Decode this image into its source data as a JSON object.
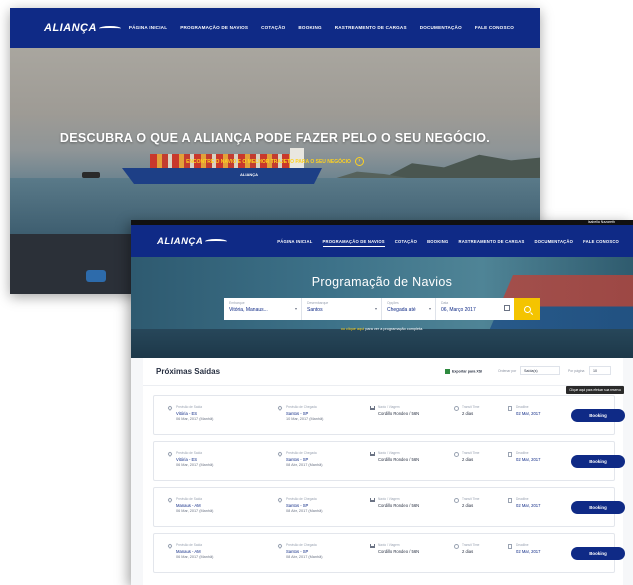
{
  "home": {
    "logo": "ALIANÇA",
    "menu": [
      "PÁGINA INICIAL",
      "PROGRAMAÇÃO DE NAVIOS",
      "COTAÇÃO",
      "BOOKING",
      "RASTREAMENTO DE CARGAS",
      "DOCUMENTAÇÃO",
      "FALE CONOSCO"
    ],
    "headline": "DESCUBRA O QUE A ALIANÇA PODE FAZER PELO O SEU NEGÓCIO.",
    "cta": "ENCONTRE O NAVIO E O MELHOR TRAJETO PARA O SEU NEGÓCIO",
    "ship_brand": "ALIANÇA"
  },
  "schedule": {
    "topbar_user": "Isabella Nazareth",
    "logo": "ALIANÇA",
    "menu": [
      "PÁGINA INICIAL",
      "PROGRAMAÇÃO DE NAVIOS",
      "COTAÇÃO",
      "BOOKING",
      "RASTREAMENTO DE CARGAS",
      "DOCUMENTAÇÃO",
      "FALE CONOSCO"
    ],
    "title": "Programação de Navios",
    "search": {
      "origin_label": "Embarque",
      "origin_value": "Vitória, Manaus...",
      "dest_label": "Desembarque",
      "dest_value": "Santos",
      "type_label": "Opções",
      "type_value": "Chegada até",
      "date_label": "Data",
      "date_value": "06, Março 2017"
    },
    "hint_link": "ou clique aqui",
    "hint_rest": "para ver a programação completa.",
    "panel_title": "Próximas Saídas",
    "export_label": "Exportar para XSl",
    "order_label": "Ordenar por",
    "order_value": "Saída(s)",
    "per_page_label": "Por página",
    "per_page_value": "10",
    "tooltip": "Clique aqui para efetuar sua reserva",
    "row_labels": {
      "origin": "Previsão de Saída",
      "dest": "Previsão de Chegada",
      "vessel": "Navio / Viagem",
      "transit": "Transit Time",
      "deadline": "Deadline",
      "book": "Booking"
    },
    "rows": [
      {
        "origin": "Vitória - ES",
        "origin_date": "06 Mar, 2017 (Manhã)",
        "dest": "Santos - SP",
        "dest_date": "10 Mar, 2017 (Manhã)",
        "vessel": "Cordillo Rondeo / 56N",
        "transit": "2 dias",
        "deadline": "02 Mar, 2017"
      },
      {
        "origin": "Vitória - ES",
        "origin_date": "06 Mar, 2017 (Manhã)",
        "dest": "Santos - SP",
        "dest_date": "08 Abr, 2017 (Manhã)",
        "vessel": "Cordillo Rondeo / 56N",
        "transit": "2 dias",
        "deadline": "02 Mar, 2017"
      },
      {
        "origin": "Manaus - AM",
        "origin_date": "06 Mar, 2017 (Manhã)",
        "dest": "Santos - SP",
        "dest_date": "08 Abr, 2017 (Manhã)",
        "vessel": "Cordillo Rondeo / 56N",
        "transit": "2 dias",
        "deadline": "02 Mar, 2017"
      },
      {
        "origin": "Manaus - AM",
        "origin_date": "06 Mar, 2017 (Manhã)",
        "dest": "Santos - SP",
        "dest_date": "08 Abr, 2017 (Manhã)",
        "vessel": "Cordillo Rondeo / 56N",
        "transit": "2 dias",
        "deadline": "02 Mar, 2017"
      }
    ]
  },
  "colors": {
    "brand_blue": "#0f2a86",
    "accent_yellow": "#f4c400"
  }
}
